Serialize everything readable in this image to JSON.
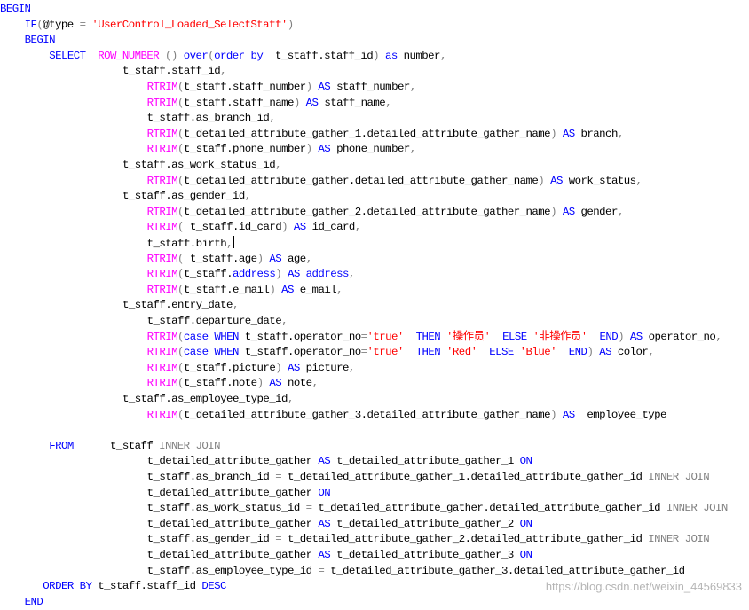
{
  "editor": {
    "lines": [
      {
        "indent": 0,
        "tokens": [
          {
            "c": "kw",
            "t": "BEGIN"
          }
        ]
      },
      {
        "indent": 4,
        "tokens": [
          {
            "c": "kw",
            "t": "IF"
          },
          {
            "c": "gray",
            "t": "("
          },
          {
            "c": "txt",
            "t": "@type "
          },
          {
            "c": "gray",
            "t": "= "
          },
          {
            "c": "str",
            "t": "'UserControl_Loaded_SelectStaff'"
          },
          {
            "c": "gray",
            "t": ")"
          }
        ]
      },
      {
        "indent": 4,
        "tokens": [
          {
            "c": "kw",
            "t": "BEGIN"
          }
        ]
      },
      {
        "indent": 8,
        "tokens": [
          {
            "c": "kw",
            "t": "SELECT  "
          },
          {
            "c": "fn",
            "t": "ROW_NUMBER "
          },
          {
            "c": "gray",
            "t": "() "
          },
          {
            "c": "kw",
            "t": "over"
          },
          {
            "c": "gray",
            "t": "("
          },
          {
            "c": "kw",
            "t": "order by  "
          },
          {
            "c": "txt",
            "t": "t_staff.staff_id"
          },
          {
            "c": "gray",
            "t": ") "
          },
          {
            "c": "kw",
            "t": "as "
          },
          {
            "c": "txt",
            "t": "number"
          },
          {
            "c": "gray",
            "t": ","
          }
        ]
      },
      {
        "indent": 20,
        "tokens": [
          {
            "c": "txt",
            "t": "t_staff.staff_id"
          },
          {
            "c": "gray",
            "t": ","
          }
        ]
      },
      {
        "indent": 24,
        "tokens": [
          {
            "c": "fn",
            "t": "RTRIM"
          },
          {
            "c": "gray",
            "t": "("
          },
          {
            "c": "txt",
            "t": "t_staff.staff_number"
          },
          {
            "c": "gray",
            "t": ") "
          },
          {
            "c": "kw",
            "t": "AS "
          },
          {
            "c": "txt",
            "t": "staff_number"
          },
          {
            "c": "gray",
            "t": ","
          }
        ]
      },
      {
        "indent": 24,
        "tokens": [
          {
            "c": "fn",
            "t": "RTRIM"
          },
          {
            "c": "gray",
            "t": "("
          },
          {
            "c": "txt",
            "t": "t_staff.staff_name"
          },
          {
            "c": "gray",
            "t": ") "
          },
          {
            "c": "kw",
            "t": "AS "
          },
          {
            "c": "txt",
            "t": "staff_name"
          },
          {
            "c": "gray",
            "t": ","
          }
        ]
      },
      {
        "indent": 24,
        "tokens": [
          {
            "c": "txt",
            "t": "t_staff.as_branch_id"
          },
          {
            "c": "gray",
            "t": ","
          }
        ]
      },
      {
        "indent": 24,
        "tokens": [
          {
            "c": "fn",
            "t": "RTRIM"
          },
          {
            "c": "gray",
            "t": "("
          },
          {
            "c": "txt",
            "t": "t_detailed_attribute_gather_1.detailed_attribute_gather_name"
          },
          {
            "c": "gray",
            "t": ") "
          },
          {
            "c": "kw",
            "t": "AS "
          },
          {
            "c": "txt",
            "t": "branch"
          },
          {
            "c": "gray",
            "t": ","
          }
        ]
      },
      {
        "indent": 24,
        "tokens": [
          {
            "c": "fn",
            "t": "RTRIM"
          },
          {
            "c": "gray",
            "t": "("
          },
          {
            "c": "txt",
            "t": "t_staff.phone_number"
          },
          {
            "c": "gray",
            "t": ") "
          },
          {
            "c": "kw",
            "t": "AS "
          },
          {
            "c": "txt",
            "t": "phone_number"
          },
          {
            "c": "gray",
            "t": ","
          }
        ]
      },
      {
        "indent": 20,
        "tokens": [
          {
            "c": "txt",
            "t": "t_staff.as_work_status_id"
          },
          {
            "c": "gray",
            "t": ","
          }
        ]
      },
      {
        "indent": 24,
        "tokens": [
          {
            "c": "fn",
            "t": "RTRIM"
          },
          {
            "c": "gray",
            "t": "("
          },
          {
            "c": "txt",
            "t": "t_detailed_attribute_gather.detailed_attribute_gather_name"
          },
          {
            "c": "gray",
            "t": ") "
          },
          {
            "c": "kw",
            "t": "AS "
          },
          {
            "c": "txt",
            "t": "work_status"
          },
          {
            "c": "gray",
            "t": ","
          }
        ]
      },
      {
        "indent": 20,
        "tokens": [
          {
            "c": "txt",
            "t": "t_staff.as_gender_id"
          },
          {
            "c": "gray",
            "t": ","
          }
        ]
      },
      {
        "indent": 24,
        "tokens": [
          {
            "c": "fn",
            "t": "RTRIM"
          },
          {
            "c": "gray",
            "t": "("
          },
          {
            "c": "txt",
            "t": "t_detailed_attribute_gather_2.detailed_attribute_gather_name"
          },
          {
            "c": "gray",
            "t": ") "
          },
          {
            "c": "kw",
            "t": "AS "
          },
          {
            "c": "txt",
            "t": "gender"
          },
          {
            "c": "gray",
            "t": ","
          }
        ]
      },
      {
        "indent": 24,
        "tokens": [
          {
            "c": "fn",
            "t": "RTRIM"
          },
          {
            "c": "gray",
            "t": "( "
          },
          {
            "c": "txt",
            "t": "t_staff.id_card"
          },
          {
            "c": "gray",
            "t": ") "
          },
          {
            "c": "kw",
            "t": "AS "
          },
          {
            "c": "txt",
            "t": "id_card"
          },
          {
            "c": "gray",
            "t": ","
          }
        ]
      },
      {
        "indent": 24,
        "caret": true,
        "tokens": [
          {
            "c": "txt",
            "t": "t_staff.birth"
          },
          {
            "c": "gray",
            "t": ","
          }
        ]
      },
      {
        "indent": 24,
        "tokens": [
          {
            "c": "fn",
            "t": "RTRIM"
          },
          {
            "c": "gray",
            "t": "( "
          },
          {
            "c": "txt",
            "t": "t_staff.age"
          },
          {
            "c": "gray",
            "t": ") "
          },
          {
            "c": "kw",
            "t": "AS "
          },
          {
            "c": "txt",
            "t": "age"
          },
          {
            "c": "gray",
            "t": ","
          }
        ]
      },
      {
        "indent": 24,
        "tokens": [
          {
            "c": "fn",
            "t": "RTRIM"
          },
          {
            "c": "gray",
            "t": "("
          },
          {
            "c": "txt",
            "t": "t_staff."
          },
          {
            "c": "kw",
            "t": "address"
          },
          {
            "c": "gray",
            "t": ") "
          },
          {
            "c": "kw",
            "t": "AS address"
          },
          {
            "c": "gray",
            "t": ","
          }
        ]
      },
      {
        "indent": 24,
        "tokens": [
          {
            "c": "fn",
            "t": "RTRIM"
          },
          {
            "c": "gray",
            "t": "("
          },
          {
            "c": "txt",
            "t": "t_staff.e_mail"
          },
          {
            "c": "gray",
            "t": ") "
          },
          {
            "c": "kw",
            "t": "AS "
          },
          {
            "c": "txt",
            "t": "e_mail"
          },
          {
            "c": "gray",
            "t": ","
          }
        ]
      },
      {
        "indent": 20,
        "tokens": [
          {
            "c": "txt",
            "t": "t_staff.entry_date"
          },
          {
            "c": "gray",
            "t": ","
          }
        ]
      },
      {
        "indent": 24,
        "tokens": [
          {
            "c": "txt",
            "t": "t_staff.departure_date"
          },
          {
            "c": "gray",
            "t": ","
          }
        ]
      },
      {
        "indent": 24,
        "tokens": [
          {
            "c": "fn",
            "t": "RTRIM"
          },
          {
            "c": "gray",
            "t": "("
          },
          {
            "c": "kw",
            "t": "case WHEN "
          },
          {
            "c": "txt",
            "t": "t_staff.operator_no"
          },
          {
            "c": "gray",
            "t": "="
          },
          {
            "c": "str",
            "t": "'true'  "
          },
          {
            "c": "kw",
            "t": "THEN "
          },
          {
            "c": "str",
            "t": "'操作员'  "
          },
          {
            "c": "kw",
            "t": "ELSE "
          },
          {
            "c": "str",
            "t": "'非操作员'  "
          },
          {
            "c": "kw",
            "t": "END"
          },
          {
            "c": "gray",
            "t": ") "
          },
          {
            "c": "kw",
            "t": "AS "
          },
          {
            "c": "txt",
            "t": "operator_no"
          },
          {
            "c": "gray",
            "t": ","
          }
        ]
      },
      {
        "indent": 24,
        "tokens": [
          {
            "c": "fn",
            "t": "RTRIM"
          },
          {
            "c": "gray",
            "t": "("
          },
          {
            "c": "kw",
            "t": "case WHEN "
          },
          {
            "c": "txt",
            "t": "t_staff.operator_no"
          },
          {
            "c": "gray",
            "t": "="
          },
          {
            "c": "str",
            "t": "'true'  "
          },
          {
            "c": "kw",
            "t": "THEN "
          },
          {
            "c": "str",
            "t": "'Red'  "
          },
          {
            "c": "kw",
            "t": "ELSE "
          },
          {
            "c": "str",
            "t": "'Blue'  "
          },
          {
            "c": "kw",
            "t": "END"
          },
          {
            "c": "gray",
            "t": ") "
          },
          {
            "c": "kw",
            "t": "AS "
          },
          {
            "c": "txt",
            "t": "color"
          },
          {
            "c": "gray",
            "t": ","
          }
        ]
      },
      {
        "indent": 24,
        "tokens": [
          {
            "c": "fn",
            "t": "RTRIM"
          },
          {
            "c": "gray",
            "t": "("
          },
          {
            "c": "txt",
            "t": "t_staff.picture"
          },
          {
            "c": "gray",
            "t": ") "
          },
          {
            "c": "kw",
            "t": "AS "
          },
          {
            "c": "txt",
            "t": "picture"
          },
          {
            "c": "gray",
            "t": ","
          }
        ]
      },
      {
        "indent": 24,
        "tokens": [
          {
            "c": "fn",
            "t": "RTRIM"
          },
          {
            "c": "gray",
            "t": "("
          },
          {
            "c": "txt",
            "t": "t_staff.note"
          },
          {
            "c": "gray",
            "t": ") "
          },
          {
            "c": "kw",
            "t": "AS "
          },
          {
            "c": "txt",
            "t": "note"
          },
          {
            "c": "gray",
            "t": ","
          }
        ]
      },
      {
        "indent": 20,
        "tokens": [
          {
            "c": "txt",
            "t": "t_staff.as_employee_type_id"
          },
          {
            "c": "gray",
            "t": ","
          }
        ]
      },
      {
        "indent": 24,
        "tokens": [
          {
            "c": "fn",
            "t": "RTRIM"
          },
          {
            "c": "gray",
            "t": "("
          },
          {
            "c": "txt",
            "t": "t_detailed_attribute_gather_3.detailed_attribute_gather_name"
          },
          {
            "c": "gray",
            "t": ") "
          },
          {
            "c": "kw",
            "t": "AS  "
          },
          {
            "c": "txt",
            "t": "employee_type"
          }
        ]
      },
      {
        "indent": 0,
        "tokens": []
      },
      {
        "indent": 8,
        "tokens": [
          {
            "c": "kw",
            "t": "FROM      "
          },
          {
            "c": "txt",
            "t": "t_staff "
          },
          {
            "c": "gray",
            "t": "INNER JOIN"
          }
        ]
      },
      {
        "indent": 24,
        "tokens": [
          {
            "c": "txt",
            "t": "t_detailed_attribute_gather "
          },
          {
            "c": "kw",
            "t": "AS "
          },
          {
            "c": "txt",
            "t": "t_detailed_attribute_gather_1 "
          },
          {
            "c": "kw",
            "t": "ON"
          }
        ]
      },
      {
        "indent": 24,
        "tokens": [
          {
            "c": "txt",
            "t": "t_staff.as_branch_id "
          },
          {
            "c": "gray",
            "t": "= "
          },
          {
            "c": "txt",
            "t": "t_detailed_attribute_gather_1.detailed_attribute_gather_id "
          },
          {
            "c": "gray",
            "t": "INNER JOIN"
          }
        ]
      },
      {
        "indent": 24,
        "tokens": [
          {
            "c": "txt",
            "t": "t_detailed_attribute_gather "
          },
          {
            "c": "kw",
            "t": "ON"
          }
        ]
      },
      {
        "indent": 24,
        "tokens": [
          {
            "c": "txt",
            "t": "t_staff.as_work_status_id "
          },
          {
            "c": "gray",
            "t": "= "
          },
          {
            "c": "txt",
            "t": "t_detailed_attribute_gather.detailed_attribute_gather_id "
          },
          {
            "c": "gray",
            "t": "INNER JOIN"
          }
        ]
      },
      {
        "indent": 24,
        "tokens": [
          {
            "c": "txt",
            "t": "t_detailed_attribute_gather "
          },
          {
            "c": "kw",
            "t": "AS "
          },
          {
            "c": "txt",
            "t": "t_detailed_attribute_gather_2 "
          },
          {
            "c": "kw",
            "t": "ON"
          }
        ]
      },
      {
        "indent": 24,
        "tokens": [
          {
            "c": "txt",
            "t": "t_staff.as_gender_id "
          },
          {
            "c": "gray",
            "t": "= "
          },
          {
            "c": "txt",
            "t": "t_detailed_attribute_gather_2.detailed_attribute_gather_id "
          },
          {
            "c": "gray",
            "t": "INNER JOIN"
          }
        ]
      },
      {
        "indent": 24,
        "tokens": [
          {
            "c": "txt",
            "t": "t_detailed_attribute_gather "
          },
          {
            "c": "kw",
            "t": "AS "
          },
          {
            "c": "txt",
            "t": "t_detailed_attribute_gather_3 "
          },
          {
            "c": "kw",
            "t": "ON"
          }
        ]
      },
      {
        "indent": 24,
        "tokens": [
          {
            "c": "txt",
            "t": "t_staff.as_employee_type_id "
          },
          {
            "c": "gray",
            "t": "= "
          },
          {
            "c": "txt",
            "t": "t_detailed_attribute_gather_3.detailed_attribute_gather_id"
          }
        ]
      },
      {
        "indent": 7,
        "tokens": [
          {
            "c": "kw",
            "t": "ORDER BY "
          },
          {
            "c": "txt",
            "t": "t_staff.staff_id "
          },
          {
            "c": "kw",
            "t": "DESC"
          }
        ]
      },
      {
        "indent": 4,
        "tokens": [
          {
            "c": "kw",
            "t": "END"
          }
        ]
      }
    ]
  },
  "watermark": "https://blog.csdn.net/weixin_44569833"
}
